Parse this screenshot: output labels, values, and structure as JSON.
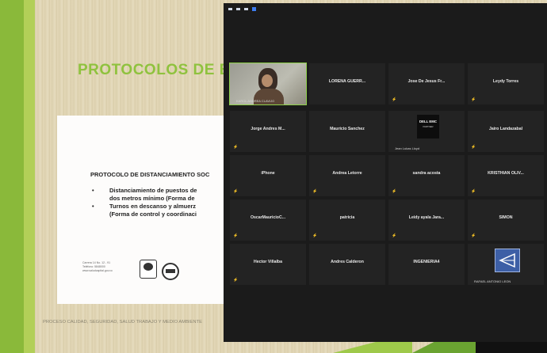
{
  "slide": {
    "title": "PROTOCOLOS DE BIO",
    "heading": "PROTOCOLO DE DISTANCIAMIENTO SOC",
    "bullets": [
      [
        "Distanciamiento de puestos de",
        "dos metros mínimo (Forma de"
      ],
      [
        "Turnos en descanso y almuerz",
        "(Forma de control y coordinaci"
      ]
    ],
    "address": [
      "Carrera 14 No. 12 - 91",
      "Teléfono: 5848000",
      "www.saludcapital.gov.co"
    ],
    "footer": "PROCESO CALIDAD, SEGURIDAD, SALUD TRABAJO Y MEDIO AMBIENTE"
  },
  "meeting": {
    "participants": [
      {
        "name": "",
        "label": "KAROL ANDREA CLAVIJO",
        "type": "video"
      },
      {
        "name": "LORENA GUERR...",
        "muted": false
      },
      {
        "name": "Jose De Jesus Fr...",
        "muted": true
      },
      {
        "name": "Leydy Torres",
        "muted": true
      },
      {
        "name": "Jorge Andres M...",
        "muted": true
      },
      {
        "name": "Mauricio Sanchez",
        "muted": false
      },
      {
        "name": "",
        "label": "Jean Lukas Lloyd",
        "type": "dell",
        "logo_top": "DELL EMC",
        "logo_bottom": "PARTNER"
      },
      {
        "name": "Jairo Landazabal",
        "muted": true
      },
      {
        "name": "iPhone",
        "muted": true
      },
      {
        "name": "Andrea Letorre",
        "muted": true
      },
      {
        "name": "sandra acosta",
        "muted": true
      },
      {
        "name": "KRISTHIAN OLIV...",
        "muted": true
      },
      {
        "name": "OscarMauricioC...",
        "muted": true
      },
      {
        "name": "patricia",
        "muted": true
      },
      {
        "name": "Leidy ayala Jara...",
        "muted": true
      },
      {
        "name": "SIMON",
        "muted": true
      },
      {
        "name": "Hector Villalba",
        "muted": true
      },
      {
        "name": "Andres Calderon",
        "muted": false
      },
      {
        "name": "INGENIERIA4",
        "muted": false
      },
      {
        "name": "",
        "label": "RAFAEL ANTONIO LEON",
        "type": "avatar"
      }
    ]
  }
}
